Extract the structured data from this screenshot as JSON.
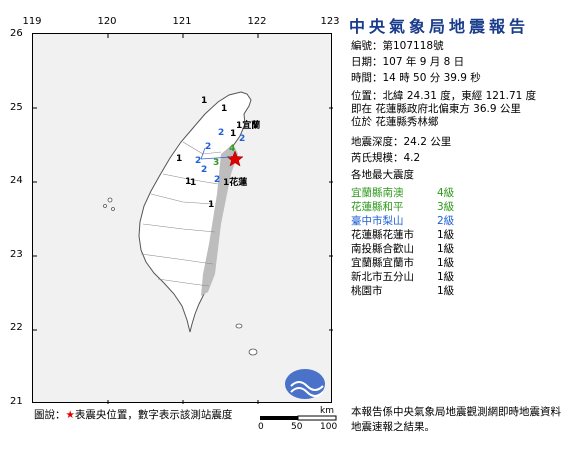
{
  "report": {
    "title": "中央氣象局地震報告",
    "number_label": "編號：",
    "number": "第107118號",
    "date_label": "日期：",
    "date": "107 年 9 月 8 日",
    "time_label": "時間：",
    "time": "14 時 50 分 39.9 秒",
    "position_label": "位置：",
    "position": "北緯 24.31 度，東經 121.71 度",
    "relative": "即在 花蓮縣政府北偏東方 36.9 公里",
    "located_in": "位於 花蓮縣秀林鄉",
    "depth_label": "地震深度：",
    "depth": "24.2 公里",
    "magnitude_label": "芮氏規模：",
    "magnitude": "4.2",
    "max_intensity_title": "各地最大震度"
  },
  "intensities": [
    {
      "location": "宜蘭縣南澳",
      "level": "4級",
      "color": "#2f9a1d"
    },
    {
      "location": "花蓮縣和平",
      "level": "3級",
      "color": "#2f9a1d"
    },
    {
      "location": "臺中市梨山",
      "level": "2級",
      "color": "#1f5fd6"
    },
    {
      "location": "花蓮縣花蓮市",
      "level": "1級",
      "color": "#000000"
    },
    {
      "location": "南投縣合歡山",
      "level": "1級",
      "color": "#000000"
    },
    {
      "location": "宜蘭縣宜蘭市",
      "level": "1級",
      "color": "#000000"
    },
    {
      "location": "新北市五分山",
      "level": "1級",
      "color": "#000000"
    },
    {
      "location": "桃園市",
      "level": "1級",
      "color": "#000000"
    }
  ],
  "map": {
    "lon_ticks": [
      "119",
      "120",
      "121",
      "122",
      "123"
    ],
    "lat_ticks": [
      "26",
      "25",
      "24",
      "23",
      "22",
      "21"
    ],
    "epicenter_color": "#e00000",
    "station_labels": [
      {
        "text": "1",
        "kind": "black"
      },
      {
        "text": "1",
        "kind": "black"
      },
      {
        "text": "1宜蘭",
        "kind": "black"
      },
      {
        "text": "1",
        "kind": "black"
      },
      {
        "text": "2",
        "kind": "blue"
      },
      {
        "text": "2",
        "kind": "blue"
      },
      {
        "text": "2",
        "kind": "blue"
      },
      {
        "text": "2",
        "kind": "blue"
      },
      {
        "text": "1",
        "kind": "black"
      },
      {
        "text": "1",
        "kind": "black"
      },
      {
        "text": "4",
        "kind": "green"
      },
      {
        "text": "3",
        "kind": "green"
      },
      {
        "text": "2",
        "kind": "blue"
      },
      {
        "text": "1",
        "kind": "black"
      },
      {
        "text": "2",
        "kind": "blue"
      },
      {
        "text": "1花蓮",
        "kind": "black"
      },
      {
        "text": "1",
        "kind": "black"
      }
    ]
  },
  "legend": {
    "prefix": "圖說：",
    "star": "★",
    "text": "表震央位置，數字表示該測站震度"
  },
  "scale": {
    "unit": "km",
    "ticks": [
      "0",
      "50",
      "100"
    ]
  },
  "footer": {
    "line1": "本報告係中央氣象局地震觀測網即時地震資料",
    "line2": "地震速報之結果。"
  }
}
